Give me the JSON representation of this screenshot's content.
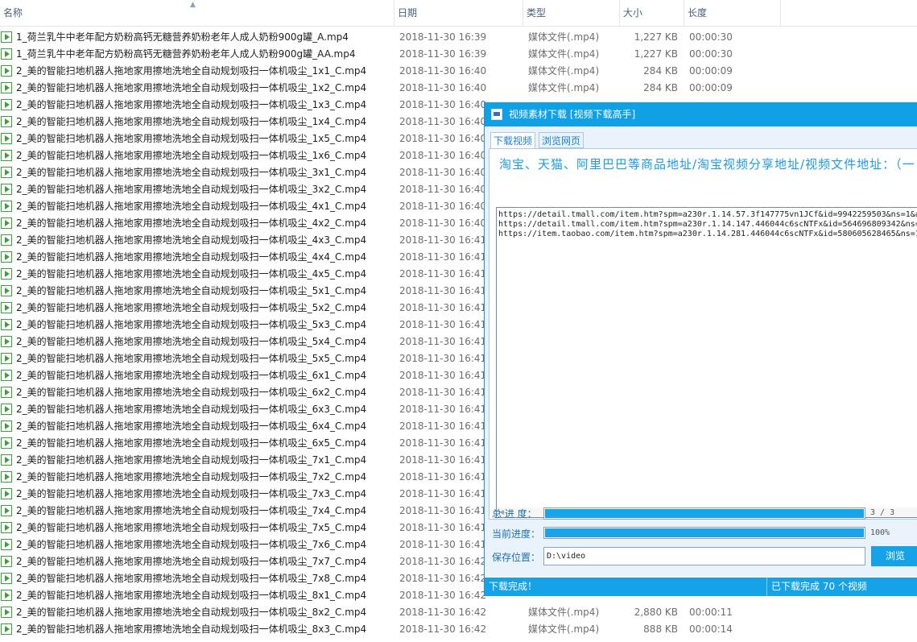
{
  "explorer": {
    "columns": {
      "name": "名称",
      "date": "日期",
      "type": "类型",
      "size": "大小",
      "length": "长度"
    },
    "rows": [
      {
        "name": "1_荷兰乳牛中老年配方奶粉高钙无糖营养奶粉老年人成人奶粉900g罐_A.mp4",
        "date": "2018-11-30 16:39",
        "type": "媒体文件(.mp4)",
        "size": "1,227 KB",
        "length": "00:00:30"
      },
      {
        "name": "1_荷兰乳牛中老年配方奶粉高钙无糖营养奶粉老年人成人奶粉900g罐_AA.mp4",
        "date": "2018-11-30 16:39",
        "type": "媒体文件(.mp4)",
        "size": "1,227 KB",
        "length": "00:00:30"
      },
      {
        "name": "2_美的智能扫地机器人拖地家用擦地洗地全自动规划吸扫一体机吸尘_1x1_C.mp4",
        "date": "2018-11-30 16:40",
        "type": "媒体文件(.mp4)",
        "size": "284 KB",
        "length": "00:00:09"
      },
      {
        "name": "2_美的智能扫地机器人拖地家用擦地洗地全自动规划吸扫一体机吸尘_1x2_C.mp4",
        "date": "2018-11-30 16:40",
        "type": "媒体文件(.mp4)",
        "size": "284 KB",
        "length": "00:00:09"
      },
      {
        "name": "2_美的智能扫地机器人拖地家用擦地洗地全自动规划吸扫一体机吸尘_1x3_C.mp4",
        "date": "2018-11-30 16:40",
        "type": "",
        "size": "",
        "length": ""
      },
      {
        "name": "2_美的智能扫地机器人拖地家用擦地洗地全自动规划吸扫一体机吸尘_1x4_C.mp4",
        "date": "2018-11-30 16:40",
        "type": "",
        "size": "",
        "length": ""
      },
      {
        "name": "2_美的智能扫地机器人拖地家用擦地洗地全自动规划吸扫一体机吸尘_1x5_C.mp4",
        "date": "2018-11-30 16:40",
        "type": "",
        "size": "",
        "length": ""
      },
      {
        "name": "2_美的智能扫地机器人拖地家用擦地洗地全自动规划吸扫一体机吸尘_1x6_C.mp4",
        "date": "2018-11-30 16:40",
        "type": "",
        "size": "",
        "length": ""
      },
      {
        "name": "2_美的智能扫地机器人拖地家用擦地洗地全自动规划吸扫一体机吸尘_3x1_C.mp4",
        "date": "2018-11-30 16:40",
        "type": "",
        "size": "",
        "length": ""
      },
      {
        "name": "2_美的智能扫地机器人拖地家用擦地洗地全自动规划吸扫一体机吸尘_3x2_C.mp4",
        "date": "2018-11-30 16:40",
        "type": "",
        "size": "",
        "length": ""
      },
      {
        "name": "2_美的智能扫地机器人拖地家用擦地洗地全自动规划吸扫一体机吸尘_4x1_C.mp4",
        "date": "2018-11-30 16:40",
        "type": "",
        "size": "",
        "length": ""
      },
      {
        "name": "2_美的智能扫地机器人拖地家用擦地洗地全自动规划吸扫一体机吸尘_4x2_C.mp4",
        "date": "2018-11-30 16:40",
        "type": "",
        "size": "",
        "length": ""
      },
      {
        "name": "2_美的智能扫地机器人拖地家用擦地洗地全自动规划吸扫一体机吸尘_4x3_C.mp4",
        "date": "2018-11-30 16:41",
        "type": "",
        "size": "",
        "length": ""
      },
      {
        "name": "2_美的智能扫地机器人拖地家用擦地洗地全自动规划吸扫一体机吸尘_4x4_C.mp4",
        "date": "2018-11-30 16:41",
        "type": "",
        "size": "",
        "length": ""
      },
      {
        "name": "2_美的智能扫地机器人拖地家用擦地洗地全自动规划吸扫一体机吸尘_4x5_C.mp4",
        "date": "2018-11-30 16:41",
        "type": "",
        "size": "",
        "length": ""
      },
      {
        "name": "2_美的智能扫地机器人拖地家用擦地洗地全自动规划吸扫一体机吸尘_5x1_C.mp4",
        "date": "2018-11-30 16:41",
        "type": "",
        "size": "",
        "length": ""
      },
      {
        "name": "2_美的智能扫地机器人拖地家用擦地洗地全自动规划吸扫一体机吸尘_5x2_C.mp4",
        "date": "2018-11-30 16:41",
        "type": "",
        "size": "",
        "length": ""
      },
      {
        "name": "2_美的智能扫地机器人拖地家用擦地洗地全自动规划吸扫一体机吸尘_5x3_C.mp4",
        "date": "2018-11-30 16:41",
        "type": "",
        "size": "",
        "length": ""
      },
      {
        "name": "2_美的智能扫地机器人拖地家用擦地洗地全自动规划吸扫一体机吸尘_5x4_C.mp4",
        "date": "2018-11-30 16:41",
        "type": "",
        "size": "",
        "length": ""
      },
      {
        "name": "2_美的智能扫地机器人拖地家用擦地洗地全自动规划吸扫一体机吸尘_5x5_C.mp4",
        "date": "2018-11-30 16:41",
        "type": "",
        "size": "",
        "length": ""
      },
      {
        "name": "2_美的智能扫地机器人拖地家用擦地洗地全自动规划吸扫一体机吸尘_6x1_C.mp4",
        "date": "2018-11-30 16:41",
        "type": "",
        "size": "",
        "length": ""
      },
      {
        "name": "2_美的智能扫地机器人拖地家用擦地洗地全自动规划吸扫一体机吸尘_6x2_C.mp4",
        "date": "2018-11-30 16:41",
        "type": "",
        "size": "",
        "length": ""
      },
      {
        "name": "2_美的智能扫地机器人拖地家用擦地洗地全自动规划吸扫一体机吸尘_6x3_C.mp4",
        "date": "2018-11-30 16:41",
        "type": "",
        "size": "",
        "length": ""
      },
      {
        "name": "2_美的智能扫地机器人拖地家用擦地洗地全自动规划吸扫一体机吸尘_6x4_C.mp4",
        "date": "2018-11-30 16:41",
        "type": "",
        "size": "",
        "length": ""
      },
      {
        "name": "2_美的智能扫地机器人拖地家用擦地洗地全自动规划吸扫一体机吸尘_6x5_C.mp4",
        "date": "2018-11-30 16:41",
        "type": "",
        "size": "",
        "length": ""
      },
      {
        "name": "2_美的智能扫地机器人拖地家用擦地洗地全自动规划吸扫一体机吸尘_7x1_C.mp4",
        "date": "2018-11-30 16:41",
        "type": "",
        "size": "",
        "length": ""
      },
      {
        "name": "2_美的智能扫地机器人拖地家用擦地洗地全自动规划吸扫一体机吸尘_7x2_C.mp4",
        "date": "2018-11-30 16:41",
        "type": "",
        "size": "",
        "length": ""
      },
      {
        "name": "2_美的智能扫地机器人拖地家用擦地洗地全自动规划吸扫一体机吸尘_7x3_C.mp4",
        "date": "2018-11-30 16:41",
        "type": "",
        "size": "",
        "length": ""
      },
      {
        "name": "2_美的智能扫地机器人拖地家用擦地洗地全自动规划吸扫一体机吸尘_7x4_C.mp4",
        "date": "2018-11-30 16:41",
        "type": "",
        "size": "",
        "length": ""
      },
      {
        "name": "2_美的智能扫地机器人拖地家用擦地洗地全自动规划吸扫一体机吸尘_7x5_C.mp4",
        "date": "2018-11-30 16:41",
        "type": "",
        "size": "",
        "length": ""
      },
      {
        "name": "2_美的智能扫地机器人拖地家用擦地洗地全自动规划吸扫一体机吸尘_7x6_C.mp4",
        "date": "2018-11-30 16:41",
        "type": "",
        "size": "",
        "length": ""
      },
      {
        "name": "2_美的智能扫地机器人拖地家用擦地洗地全自动规划吸扫一体机吸尘_7x7_C.mp4",
        "date": "2018-11-30 16:42",
        "type": "",
        "size": "",
        "length": ""
      },
      {
        "name": "2_美的智能扫地机器人拖地家用擦地洗地全自动规划吸扫一体机吸尘_7x8_C.mp4",
        "date": "2018-11-30 16:42",
        "type": "",
        "size": "",
        "length": ""
      },
      {
        "name": "2_美的智能扫地机器人拖地家用擦地洗地全自动规划吸扫一体机吸尘_8x1_C.mp4",
        "date": "2018-11-30 16:42",
        "type": "",
        "size": "",
        "length": ""
      },
      {
        "name": "2_美的智能扫地机器人拖地家用擦地洗地全自动规划吸扫一体机吸尘_8x2_C.mp4",
        "date": "2018-11-30 16:42",
        "type": "媒体文件(.mp4)",
        "size": "2,880 KB",
        "length": "00:00:11"
      },
      {
        "name": "2_美的智能扫地机器人拖地家用擦地洗地全自动规划吸扫一体机吸尘_8x3_C.mp4",
        "date": "2018-11-30 16:42",
        "type": "媒体文件(.mp4)",
        "size": "888 KB",
        "length": "00:00:14"
      }
    ]
  },
  "downloader": {
    "title": "视频素材下载 [视频下载高手]",
    "tabs": [
      "下载视频",
      "浏览网页"
    ],
    "prompt": "淘宝、天猫、阿里巴巴等商品地址/淘宝视频分享地址/视频文件地址：（一",
    "urls": [
      "https://detail.tmall.com/item.htm?spm=a230r.1.14.57.3f147775vn1JCf&id=9942259503&ns=1&a",
      "https://detail.tmall.com/item.htm?spm=a230r.1.14.147.446044c6scNTFx&id=564696809342&ns=",
      "https://item.taobao.com/item.htm?spm=a230r.1.14.281.446044c6scNTFx&id=580605628465&ns=1"
    ],
    "total_progress_label": "总 进 度：",
    "total_progress_text": "3 / 3",
    "total_progress_fraction": 1.0,
    "current_progress_label": "当前进度：",
    "current_progress_text": "100%",
    "current_progress_fraction": 1.0,
    "save_label": "保存位置：",
    "save_path": "D:\\video",
    "browse_label": "浏览",
    "status_left": "下载完成！",
    "status_right": "已下载完成 70 个视频",
    "accent_color": "#16a2e6"
  }
}
